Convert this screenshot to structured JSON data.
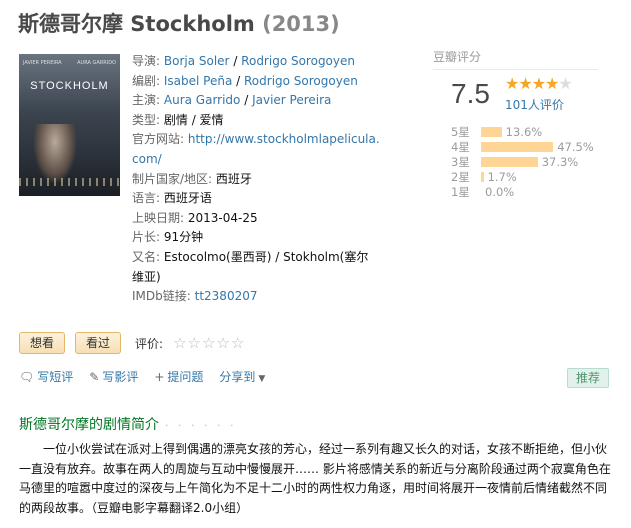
{
  "movie": {
    "title": "斯德哥尔摩 Stockholm",
    "year": "(2013)"
  },
  "poster": {
    "actor_left": "JAVIER PEREIRA",
    "actor_right": "AURA GARRIDO",
    "title": "STOCKHOLM"
  },
  "info": {
    "director_label": "导演:",
    "director_1": "Borja Soler",
    "director_2": "Rodrigo Sorogoyen",
    "writer_label": "编剧:",
    "writer_1": "Isabel Peña",
    "writer_2": "Rodrigo Sorogoyen",
    "cast_label": "主演:",
    "cast_1": "Aura Garrido",
    "cast_2": "Javier Pereira",
    "genre_label": "类型:",
    "genre": "剧情 / 爱情",
    "website_label": "官方网站:",
    "website": "http://www.stockholmlapelicula.com/",
    "country_label": "制片国家/地区:",
    "country": "西班牙",
    "language_label": "语言:",
    "language": "西班牙语",
    "release_label": "上映日期:",
    "release": "2013-04-25",
    "runtime_label": "片长:",
    "runtime": "91分钟",
    "aka_label": "又名:",
    "aka": "Estocolmo(墨西哥) / Stokholm(塞尔维亚)",
    "imdb_label": "IMDb链接:",
    "imdb": "tt2380207"
  },
  "rating": {
    "title": "豆瓣评分",
    "score": "7.5",
    "stars_filled": 4,
    "votes": "101人评价",
    "distribution": [
      {
        "label": "5星",
        "percent": 13.6,
        "text": "13.6%"
      },
      {
        "label": "4星",
        "percent": 47.5,
        "text": "47.5%"
      },
      {
        "label": "3星",
        "percent": 37.3,
        "text": "37.3%"
      },
      {
        "label": "2星",
        "percent": 1.7,
        "text": "1.7%"
      },
      {
        "label": "1星",
        "percent": 0.0,
        "text": "0.0%"
      }
    ]
  },
  "actions": {
    "want": "想看",
    "seen": "看过",
    "rate_label": "评价:",
    "stars": "☆☆☆☆☆"
  },
  "tools": {
    "short_review": "写短评",
    "review": "写影评",
    "question": "提问题",
    "share": "分享到",
    "recommend": "推荐"
  },
  "synopsis": {
    "title": "斯德哥尔摩的剧情简介",
    "dots": "· · · · · ·",
    "text": "一位小伙尝试在派对上得到偶遇的漂亮女孩的芳心，经过一系列有趣又长久的对话，女孩不断拒绝，但小伙一直没有放弃。故事在两人的周旋与互动中慢慢展开…… 影片将感情关系的新近与分离阶段通过两个寂寞角色在马德里的喧嚣中度过的深夜与上午简化为不足十二小时的两性权力角逐，用时间将展开一夜情前后情绪截然不同的两段故事。（豆瓣电影字幕翻译2.0小组）"
  },
  "colors": {
    "link": "#3377aa",
    "star": "#f6a623",
    "bar": "#ffd596",
    "section": "#007722"
  }
}
